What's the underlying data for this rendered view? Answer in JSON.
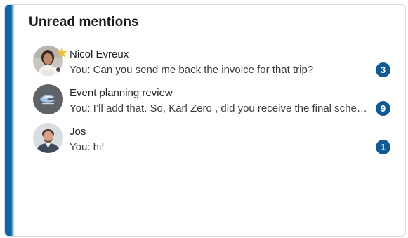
{
  "card": {
    "title": "Unread mentions"
  },
  "mentions": [
    {
      "name": "Nicol Evreux",
      "preview": "You: Can you send me back the invoice for that trip?",
      "unread": "3",
      "avatar": "person-photo",
      "favorite": true,
      "presence": "offline"
    },
    {
      "name": "Event planning review",
      "preview": "You: I’ll add that. So, Karl Zero , did you receive the final schedule?",
      "unread": "9",
      "avatar": "group-icon"
    },
    {
      "name": "Jos",
      "preview": "You: hi!",
      "unread": "1",
      "avatar": "person-photo"
    }
  ],
  "colors": {
    "accent": "#0a66a8",
    "badge": "#0f5a96",
    "star": "#f2c12e"
  }
}
